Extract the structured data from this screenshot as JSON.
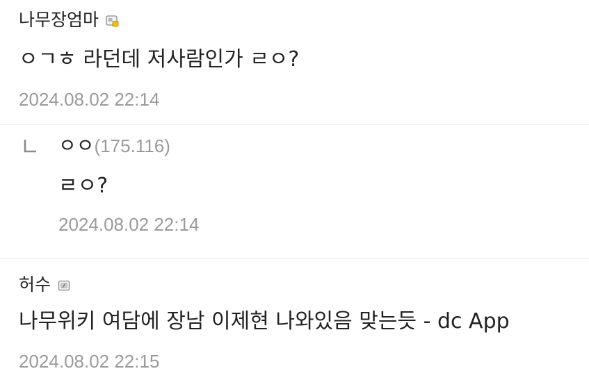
{
  "comments": [
    {
      "nickname": "나무장엄마",
      "badge_icon": "gallery-member-icon",
      "text": "ㅇㄱㅎ 라던데 저사람인가 ㄹㅇ?",
      "date": "2024.08.02 22:14"
    },
    {
      "reply_icon": "reply-arrow-icon",
      "nickname": "ㅇㅇ",
      "ip": "(175.116)",
      "text": "ㄹㅇ?",
      "date": "2024.08.02 22:14"
    },
    {
      "nickname": "허수",
      "badge_icon": "fixed-nick-icon",
      "text": "나무위키 여담에 장남 이제현 나와있음 맞는듯 - dc App",
      "date": "2024.08.02 22:15"
    }
  ],
  "colors": {
    "text": "#222222",
    "meta": "#9a9a9a",
    "divider": "#ececec",
    "badge_yellow": "#f2c200"
  }
}
